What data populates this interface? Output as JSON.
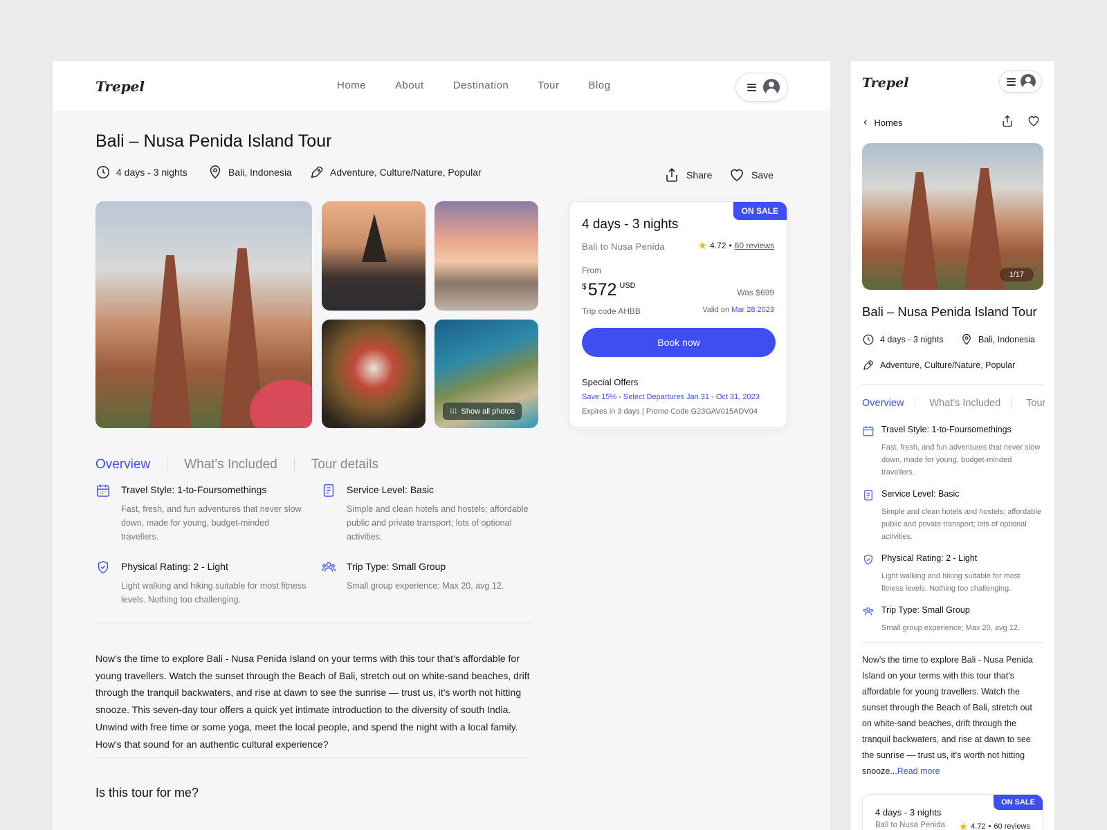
{
  "brand": "Trepel",
  "nav": [
    "Home",
    "About",
    "Destination",
    "Tour",
    "Blog"
  ],
  "tour": {
    "title": "Bali – Nusa Penida Island Tour",
    "duration": "4 days - 3 nights",
    "location": "Bali, Indonesia",
    "categories": "Adventure, Culture/Nature, Popular"
  },
  "actions": {
    "share": "Share",
    "save": "Save"
  },
  "gallery": {
    "show_all": "Show all photos",
    "counter": "1/17"
  },
  "booking": {
    "badge": "ON SALE",
    "title": "4 days - 3 nights",
    "subtitle": "Bali to Nusa Penida",
    "rating": "4.72",
    "reviews": "60 reviews",
    "from_label": "From",
    "currency_symbol": "$",
    "price": "572",
    "currency": "USD",
    "was": "Was $699",
    "trip_code": "Trip code AHBB",
    "valid_label": "Valid on",
    "valid_date": "Mar 28 2023",
    "book_label": "Book now",
    "special_offers_title": "Special Offers",
    "special_offer": "Save 15% - Select Departures Jan 31 - Oct 31, 2023",
    "expires": "Expires in 3 days | Promo Code G23GAV015ADV04"
  },
  "tabs": [
    "Overview",
    "What's Included",
    "Tour details"
  ],
  "mobile_tabs": [
    "Overview",
    "What's Included",
    "Tour"
  ],
  "features": [
    {
      "title": "Travel Style: 1-to-Foursomethings",
      "desc": "Fast, fresh, and fun adventures that never slow down, made for young, budget-minded travellers.",
      "icon": "calendar-icon"
    },
    {
      "title": "Service Level: Basic",
      "desc": "Simple and clean hotels and hostels; affordable public and private transport; lots of optional activities.",
      "icon": "document-icon"
    },
    {
      "title": "Physical Rating: 2 - Light",
      "desc": "Light walking and hiking suitable for most fitness levels. Nothing too challenging.",
      "icon": "shield-check-icon"
    },
    {
      "title": "Trip Type: Small Group",
      "desc": "Small group experience; Max 20, avg 12.",
      "icon": "group-icon"
    }
  ],
  "description": "Now's the time to explore Bali - Nusa Penida Island on your terms with this tour that's affordable for young travellers. Watch the sunset through the Beach of Bali, stretch out on white-sand beaches, drift through the tranquil backwaters, and rise at dawn to see the sunrise — trust us, it's worth not hitting snooze. This seven-day tour offers a quick yet intimate introduction to the diversity of south India. Unwind with free time or some yoga, meet the local people, and spend the night with a local family. How's that sound for an authentic cultural experience?",
  "mobile_description": "Now's the time to explore Bali - Nusa Penida Island on your terms with this tour that's affordable for young travellers. Watch the sunset through the Beach of Bali, stretch out on white-sand beaches, drift through the tranquil backwaters, and rise at dawn to see the sunrise — trust us, it's worth not hitting snooze...",
  "read_more": "Read more",
  "section_heading": "Is this tour for me?",
  "mobile_back": "Homes",
  "colors": {
    "accent": "#3d4ef2",
    "star": "#f5b90b"
  }
}
